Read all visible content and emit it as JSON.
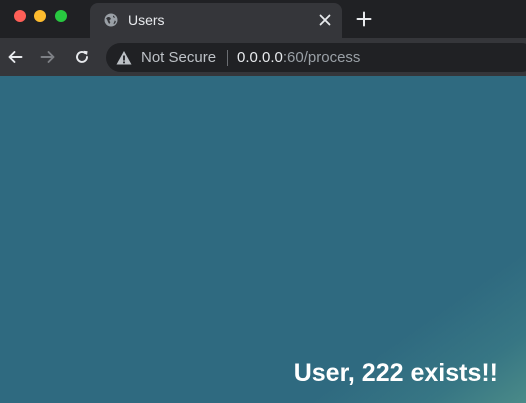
{
  "window": {
    "controls": [
      "close",
      "minimize",
      "maximize"
    ]
  },
  "tab": {
    "title": "Users",
    "favicon": "globe-icon",
    "close_icon": "close-icon"
  },
  "new_tab_icon": "plus-icon",
  "toolbar": {
    "back_icon": "arrow-left-icon",
    "forward_icon": "arrow-right-icon",
    "reload_icon": "reload-icon"
  },
  "address_bar": {
    "security_icon": "warning-icon",
    "security_label": "Not Secure",
    "url_host": "0.0.0.0",
    "url_rest": ":60/process"
  },
  "page": {
    "message": "User, 222 exists!!"
  },
  "colors": {
    "tabbar_bg": "#202124",
    "active_tab_bg": "#35363a",
    "page_bg": "#2f6a80",
    "message_text": "#ffffff"
  }
}
